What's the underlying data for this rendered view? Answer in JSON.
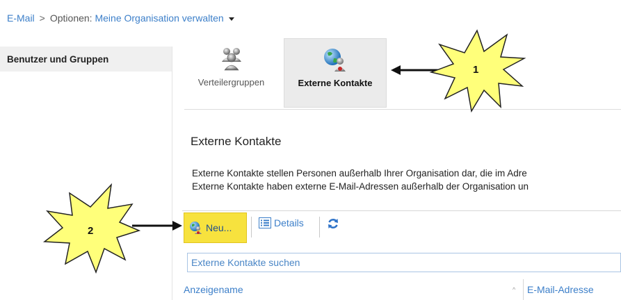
{
  "breadcrumb": {
    "email": "E-Mail",
    "separator": ">",
    "options": "Optionen:",
    "current": "Meine Organisation verwalten"
  },
  "leftnav": {
    "items": [
      {
        "label": "Benutzer und Gruppen",
        "selected": true
      }
    ]
  },
  "ribbon": {
    "tiles": [
      {
        "label": "Verteilergruppen",
        "icon": "group-icon",
        "selected": false
      },
      {
        "label": "Externe Kontakte",
        "icon": "external-contact-icon",
        "selected": true
      }
    ]
  },
  "section": {
    "title": "Externe Kontakte",
    "description_lines": [
      "Externe Kontakte stellen Personen außerhalb Ihrer Organisation dar, die im Adre",
      "Externe Kontakte haben externe E-Mail-Adressen außerhalb der Organisation un"
    ]
  },
  "toolbar": {
    "new_label": "Neu...",
    "details_label": "Details",
    "refresh_icon": "refresh-icon"
  },
  "search": {
    "placeholder": "Externe Kontakte suchen"
  },
  "table": {
    "columns": [
      "Anzeigename",
      "E-Mail-Adresse"
    ],
    "sort_indicator": "^"
  },
  "annotations": [
    {
      "number": "1"
    },
    {
      "number": "2"
    }
  ],
  "colors": {
    "link": "#3c7fc9",
    "highlight": "#f7e23e",
    "star_fill": "#ffff7a"
  }
}
